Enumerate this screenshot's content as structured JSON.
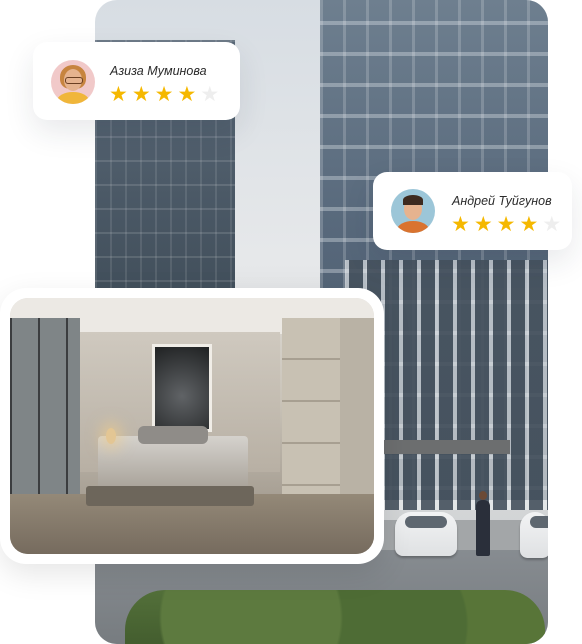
{
  "reviews": [
    {
      "name": "Азиза Муминова",
      "rating": 4,
      "max_rating": 5
    },
    {
      "name": "Андрей Туйгунов",
      "rating": 4,
      "max_rating": 5
    }
  ],
  "colors": {
    "star_filled": "#f5b800",
    "star_empty": "#eeeeee",
    "card_background": "#ffffff"
  },
  "icons": {
    "star": "star-icon"
  }
}
